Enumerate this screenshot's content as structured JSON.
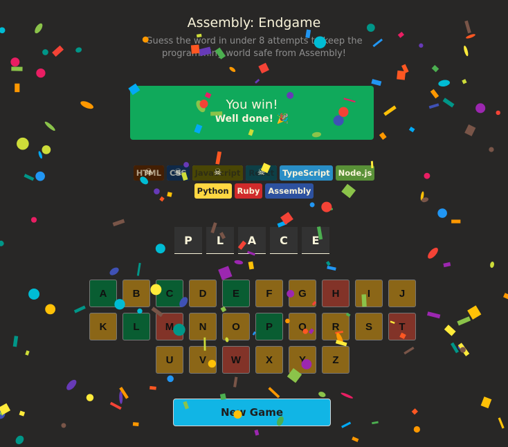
{
  "header": {
    "title": "Assembly: Endgame",
    "subtitle": "Guess the word in under 8 attempts to keep the programming world safe from Assembly!"
  },
  "status": {
    "heading": "You win!",
    "message": "Well done! 🎉"
  },
  "languages": [
    {
      "name": "HTML",
      "bg": "#E2680F",
      "color": "#F9F4DA",
      "lost": true
    },
    {
      "name": "CSS",
      "bg": "#328AF1",
      "color": "#F9F4DA",
      "lost": true
    },
    {
      "name": "JavaScript",
      "bg": "#F4EB13",
      "color": "#1E1E1E",
      "lost": true
    },
    {
      "name": "React",
      "bg": "#2ED3E9",
      "color": "#1E1E1E",
      "lost": true
    },
    {
      "name": "TypeScript",
      "bg": "#298EC6",
      "color": "#F9F4DA",
      "lost": false
    },
    {
      "name": "Node.js",
      "bg": "#599137",
      "color": "#F9F4DA",
      "lost": false
    },
    {
      "name": "Python",
      "bg": "#FFD742",
      "color": "#1E1E1E",
      "lost": false
    },
    {
      "name": "Ruby",
      "bg": "#D02B2B",
      "color": "#F9F4DA",
      "lost": false
    },
    {
      "name": "Assembly",
      "bg": "#2D519F",
      "color": "#F9F4DA",
      "lost": false
    }
  ],
  "word": [
    "P",
    "L",
    "A",
    "C",
    "E"
  ],
  "keyboard": [
    {
      "key": "A",
      "state": "correct"
    },
    {
      "key": "B",
      "state": "unused"
    },
    {
      "key": "C",
      "state": "correct"
    },
    {
      "key": "D",
      "state": "unused"
    },
    {
      "key": "E",
      "state": "correct"
    },
    {
      "key": "F",
      "state": "unused"
    },
    {
      "key": "G",
      "state": "unused"
    },
    {
      "key": "H",
      "state": "wrong"
    },
    {
      "key": "I",
      "state": "unused"
    },
    {
      "key": "J",
      "state": "unused"
    },
    {
      "key": "K",
      "state": "unused"
    },
    {
      "key": "L",
      "state": "correct"
    },
    {
      "key": "M",
      "state": "wrong"
    },
    {
      "key": "N",
      "state": "unused"
    },
    {
      "key": "O",
      "state": "unused"
    },
    {
      "key": "P",
      "state": "correct"
    },
    {
      "key": "Q",
      "state": "unused"
    },
    {
      "key": "R",
      "state": "unused"
    },
    {
      "key": "S",
      "state": "unused"
    },
    {
      "key": "T",
      "state": "wrong"
    },
    {
      "key": "U",
      "state": "unused"
    },
    {
      "key": "V",
      "state": "unused"
    },
    {
      "key": "W",
      "state": "wrong"
    },
    {
      "key": "X",
      "state": "unused"
    },
    {
      "key": "Y",
      "state": "unused"
    },
    {
      "key": "Z",
      "state": "unused"
    }
  ],
  "new_game_label": "New Game",
  "skull_icon": "skull-icon",
  "confetti_colors": [
    "#f44336",
    "#e91e63",
    "#9c27b0",
    "#673ab7",
    "#3f51b5",
    "#2196f3",
    "#03a9f4",
    "#00bcd4",
    "#009688",
    "#4CAF50",
    "#8BC34A",
    "#CDDC39",
    "#FFEB3B",
    "#FFC107",
    "#FF9800",
    "#FF5722",
    "#795548"
  ]
}
